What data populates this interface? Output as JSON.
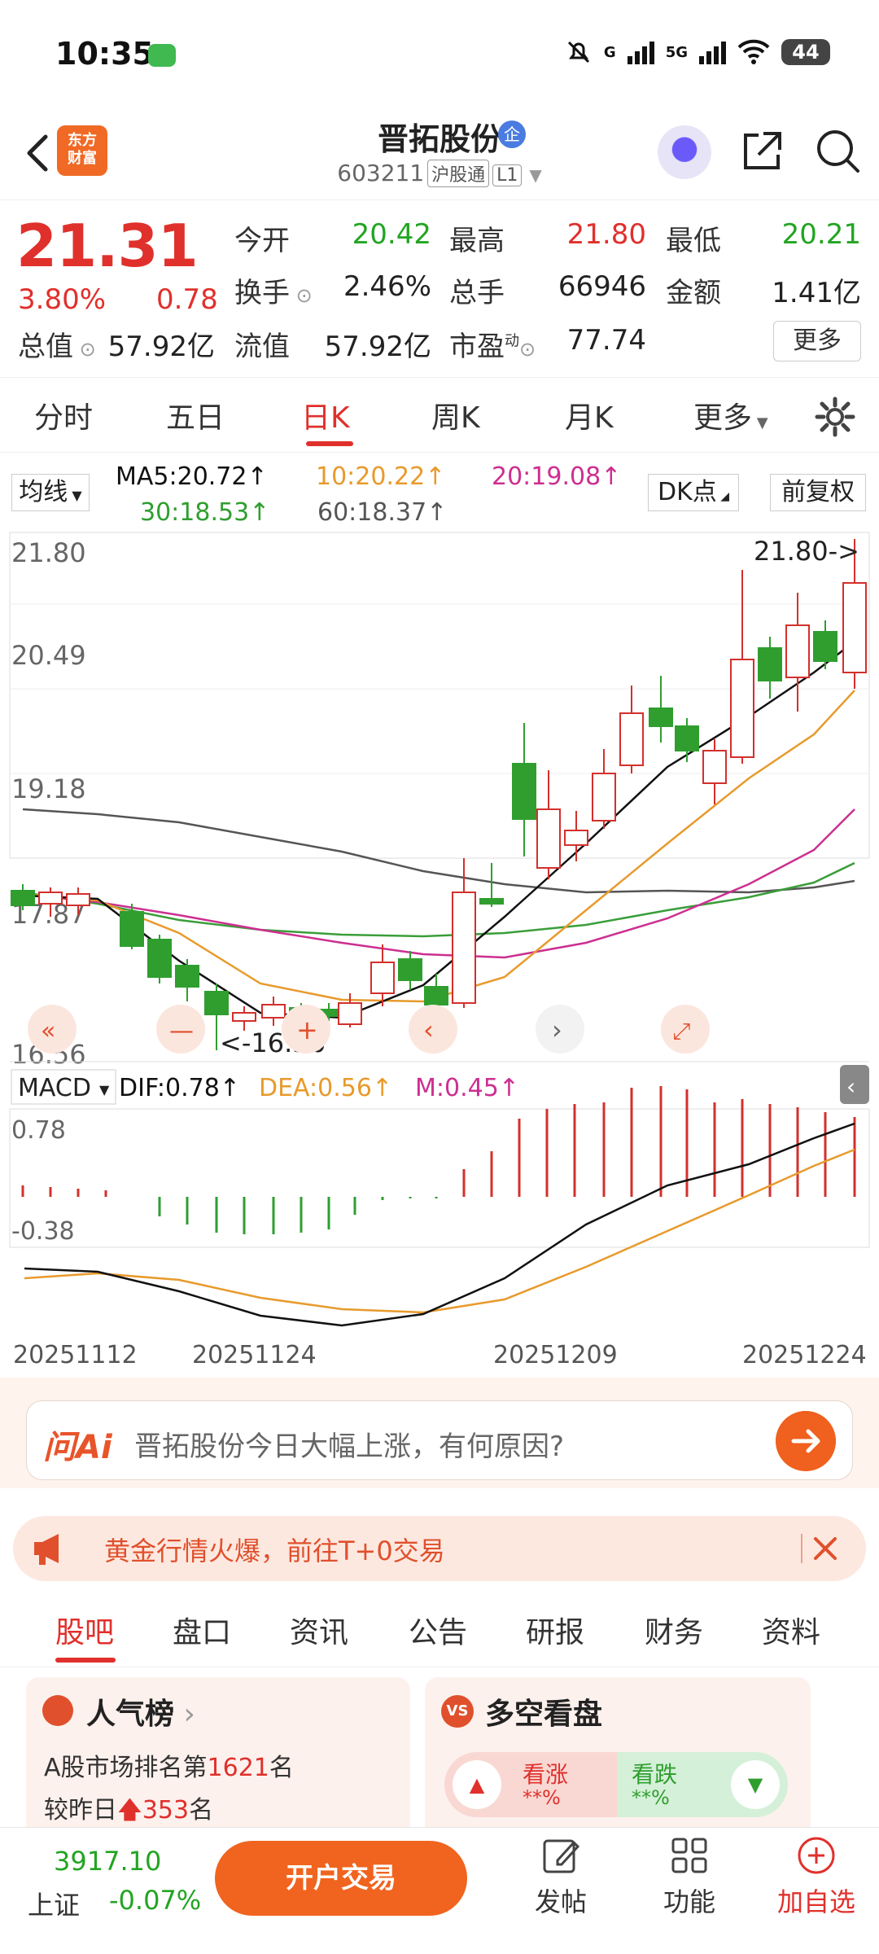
{
  "status_bar": {
    "time": "10:35",
    "network": "5G",
    "signal_label": "G",
    "battery": "44"
  },
  "header": {
    "logo_line1": "东方",
    "logo_line2": "财富",
    "stock_name": "晋拓股份",
    "badge": "企",
    "code": "603211",
    "connect": "沪股通",
    "level": "L1"
  },
  "quote": {
    "price": "21.31",
    "change_pct": "3.80%",
    "change_amt": "0.78",
    "open_label": "今开",
    "open": "20.42",
    "high_label": "最高",
    "high": "21.80",
    "low_label": "最低",
    "low": "20.21",
    "turnover_label": "换手",
    "turnover": "2.46%",
    "volume_label": "总手",
    "volume": "66946",
    "amount_label": "金额",
    "amount": "1.41亿",
    "mktcap_label": "总值",
    "mktcap": "57.92亿",
    "float_label": "流值",
    "float": "57.92亿",
    "pe_label": "市盈",
    "pe_sup": "动",
    "pe": "77.74",
    "more": "更多"
  },
  "period_tabs": [
    "分时",
    "五日",
    "日K",
    "周K",
    "月K",
    "更多"
  ],
  "ma": {
    "select": "均线",
    "ma5": "MA5:20.72",
    "ma10": "10:20.22",
    "ma20": "20:19.08",
    "ma30": "30:18.53",
    "ma60": "60:18.37",
    "dk": "DK点",
    "fq": "前复权"
  },
  "chart_data": {
    "type": "candlestick",
    "price_axis_labels": [
      "21.80",
      "20.49",
      "19.18",
      "17.87",
      "16.56"
    ],
    "high_marker": "21.80->",
    "low_marker": "<-16.56",
    "dates": [
      "20251112",
      "20251124",
      "20251209",
      "20251224"
    ],
    "macd": {
      "select": "MACD",
      "dif": "DIF:0.78",
      "dea": "DEA:0.56",
      "m": "M:0.45",
      "axis_labels": [
        "0.78",
        "-0.38"
      ]
    },
    "colors": {
      "up": "#d3302c",
      "down": "#2f9e2f",
      "ma5": "#111111",
      "ma10": "#e89a2c",
      "ma20": "#cc2f90",
      "ma30": "#3a9e3a",
      "ma60": "#555555"
    }
  },
  "ai": {
    "logo": "问Ai",
    "prompt": "晋拓股份今日大幅上涨，有何原因?"
  },
  "promo": {
    "text": "黄金行情火爆，前往T+0交易"
  },
  "info_tabs": [
    "股吧",
    "盘口",
    "资讯",
    "公告",
    "研报",
    "财务",
    "资料"
  ],
  "cards": {
    "popularity": {
      "title": "人气榜",
      "line1_pre": "A股市场排名第",
      "rank": "1621",
      "line1_post": "名",
      "line2_pre": "较昨日",
      "delta": "353",
      "line2_post": "名"
    },
    "vs": {
      "title": "多空看盘",
      "bull": "看涨",
      "bear": "看跌",
      "bull_val": "**%",
      "bear_val": "**%"
    }
  },
  "bottom_nav": {
    "index_value": "3917.10",
    "index_name": "上证",
    "index_change": "-0.07%",
    "open_account": "开户交易",
    "post": "发帖",
    "func": "功能",
    "watch": "加自选"
  }
}
